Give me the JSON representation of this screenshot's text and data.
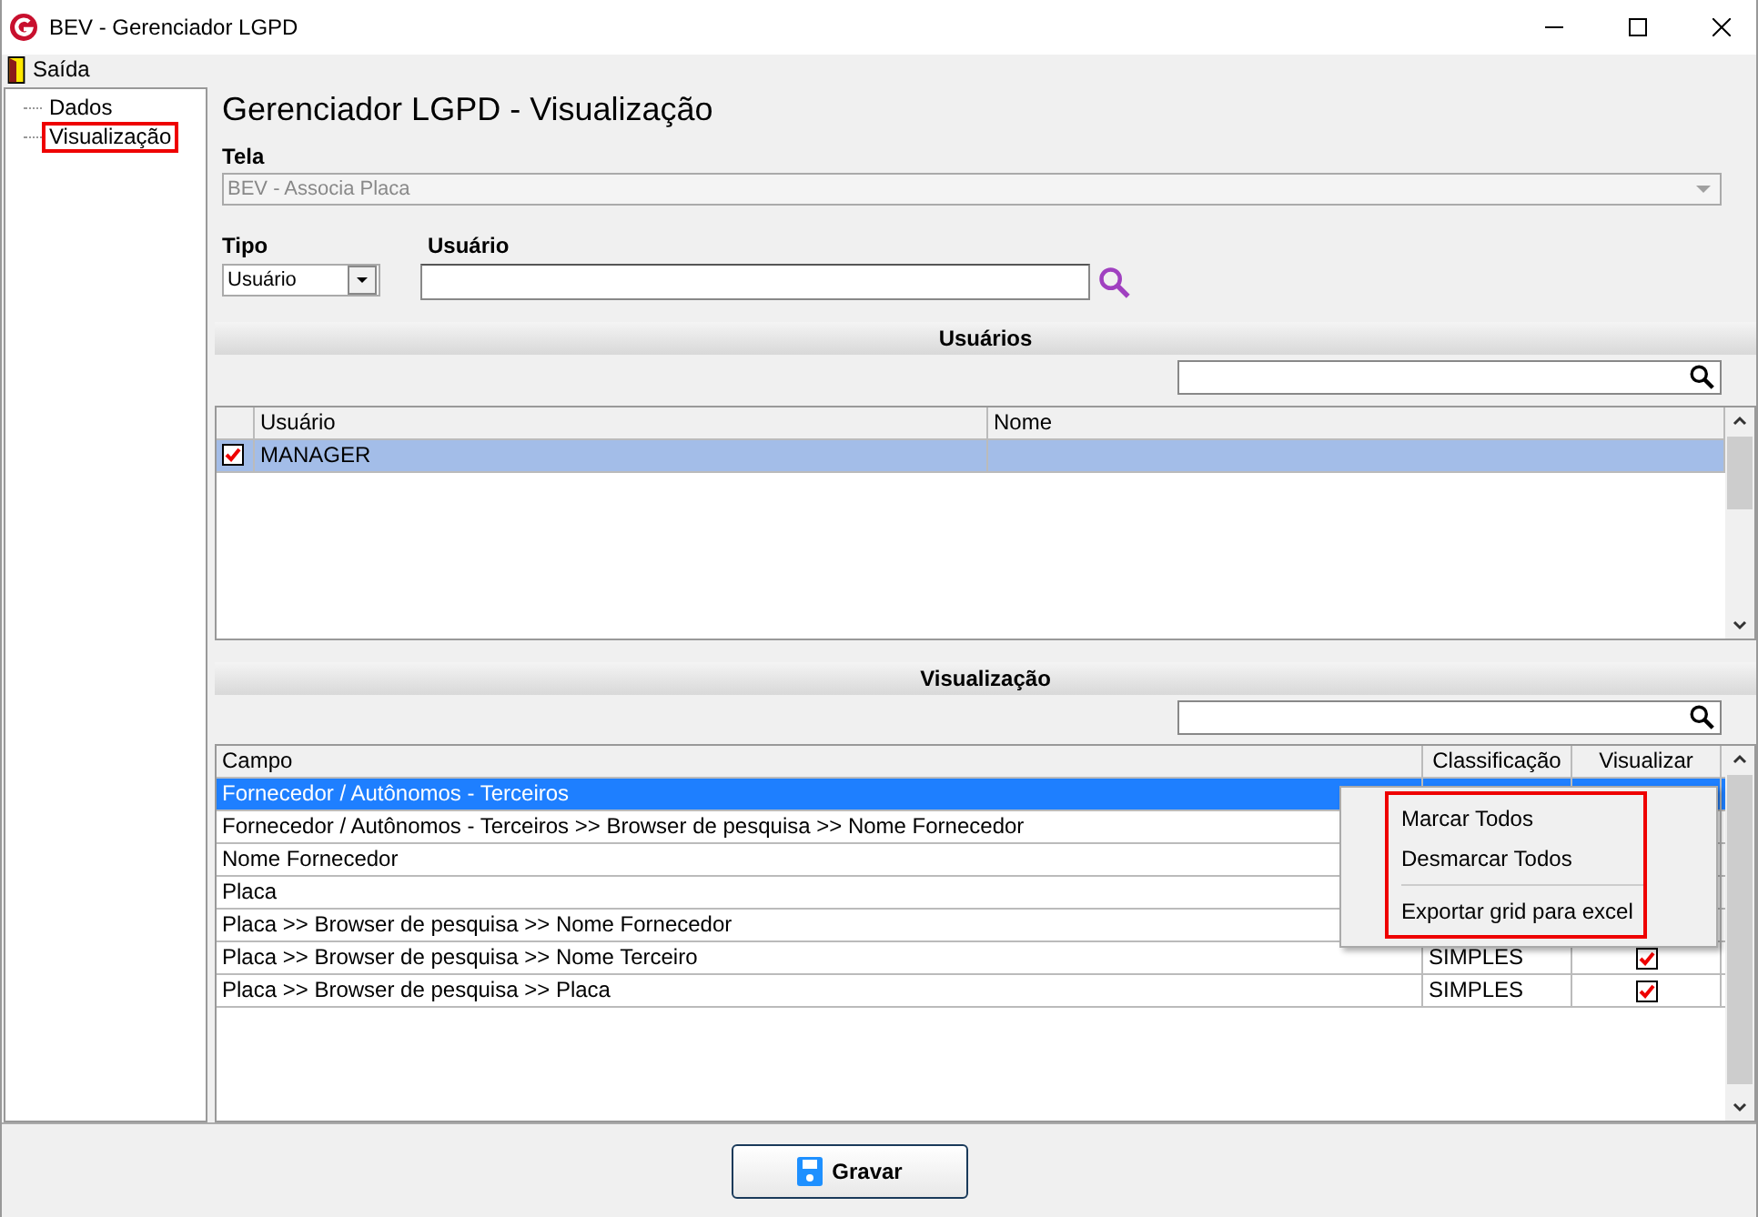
{
  "window": {
    "title": "BEV - Gerenciador LGPD"
  },
  "menu_bar": [
    {
      "label": "Saída"
    }
  ],
  "tree": [
    {
      "label": "Dados",
      "highlighted": false
    },
    {
      "label": "Visualização",
      "highlighted": true
    }
  ],
  "heading": "Gerenciador LGPD - Visualização",
  "tela": {
    "label": "Tela",
    "value": "BEV - Associa Placa",
    "disabled": true
  },
  "tipo": {
    "label": "Tipo",
    "value": "Usuário"
  },
  "usuario": {
    "label": "Usuário"
  },
  "users_section": {
    "title": "Usuários",
    "columns": [
      "Usuário",
      "Nome"
    ],
    "rows": [
      {
        "checked": true,
        "selected": true,
        "cells": [
          "MANAGER",
          ""
        ]
      }
    ]
  },
  "fields_section": {
    "title": "Visualização",
    "columns": [
      "Campo",
      "Classificação",
      "Visualizar"
    ],
    "rows": [
      {
        "campo": "Fornecedor / Autônomos - Terceiros",
        "selected": true
      },
      {
        "campo": "Fornecedor / Autônomos - Terceiros >> Browser de pesquisa >> Nome Fornecedor",
        "selected": false
      },
      {
        "campo": "Nome Fornecedor",
        "selected": false
      },
      {
        "campo": "Placa",
        "selected": false
      },
      {
        "campo": "Placa >> Browser de pesquisa >> Nome Fornecedor",
        "selected": false
      },
      {
        "campo": "Placa >> Browser de pesquisa >> Nome Terceiro",
        "classificacao": "SIMPLES",
        "selected": false,
        "checked": true
      },
      {
        "campo": "Placa >> Browser de pesquisa >> Placa",
        "classificacao": "SIMPLES",
        "selected": false,
        "checked": true
      }
    ]
  },
  "context_menu": {
    "highlighted": true,
    "items": [
      {
        "label": "Marcar Todos",
        "kind": "item"
      },
      {
        "label": "Desmarcar Todos",
        "kind": "item"
      },
      {
        "kind": "separator"
      },
      {
        "label": "Exportar grid para excel",
        "kind": "item"
      }
    ]
  },
  "save_button": {
    "label": "Gravar"
  }
}
